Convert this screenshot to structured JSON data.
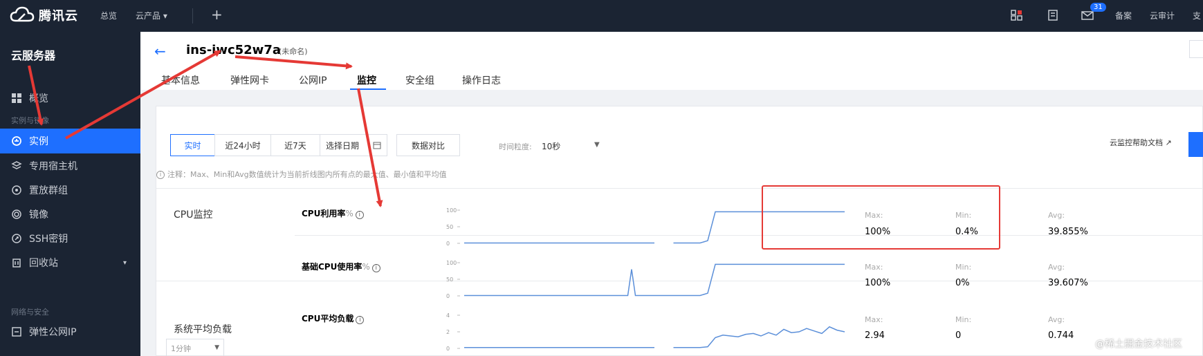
{
  "topbar": {
    "brand": "腾讯云",
    "nav": [
      "总览",
      "云产品 ▾"
    ],
    "plus": "+",
    "badge_count": "31",
    "right_links": [
      "备案",
      "云审计",
      "支"
    ]
  },
  "sidebar": {
    "title": "云服务器",
    "items": [
      {
        "label": "概览",
        "icon": "grid-icon"
      },
      {
        "label": "实例",
        "icon": "instance-icon",
        "active": true
      },
      {
        "label": "专用宿主机",
        "icon": "host-icon"
      },
      {
        "label": "置放群组",
        "icon": "placement-icon"
      },
      {
        "label": "镜像",
        "icon": "image-icon"
      },
      {
        "label": "SSH密钥",
        "icon": "key-icon"
      },
      {
        "label": "回收站",
        "icon": "trash-icon"
      },
      {
        "label": "弹性公网IP",
        "icon": "eip-icon"
      }
    ],
    "sections": [
      "实例与镜像",
      "网络与安全"
    ]
  },
  "header": {
    "instance_id": "ins-iwc52w7a",
    "instance_name": "(未命名)",
    "tabs": [
      "基本信息",
      "弹性网卡",
      "公网IP",
      "监控",
      "安全组",
      "操作日志"
    ],
    "active_tab": "监控"
  },
  "toolbar": {
    "segments": [
      "实时",
      "近24小时",
      "近7天",
      "选择日期"
    ],
    "compare": "数据对比",
    "granularity_label": "时间粒度:",
    "granularity_value": "10秒",
    "help": "云监控帮助文档"
  },
  "note": "注释：Max、Min和Avg数值统计为当前折线图内所有点的最大值、最小值和平均值",
  "groups": [
    {
      "label": "CPU监控"
    },
    {
      "label": "系统平均负载",
      "select": "1分钟"
    }
  ],
  "metrics": [
    {
      "name": "CPU利用率",
      "unit": "%",
      "max_label": "Max:",
      "max": "100%",
      "min_label": "Min:",
      "min": "0.4%",
      "avg_label": "Avg:",
      "avg": "39.855%"
    },
    {
      "name": "基础CPU使用率",
      "unit": "%",
      "max_label": "Max:",
      "max": "100%",
      "min_label": "Min:",
      "min": "0%",
      "avg_label": "Avg:",
      "avg": "39.607%"
    },
    {
      "name": "CPU平均负载",
      "unit": "",
      "max_label": "Max:",
      "max": "2.94",
      "min_label": "Min:",
      "min": "0",
      "avg_label": "Avg:",
      "avg": "0.744"
    }
  ],
  "chart_data": [
    {
      "type": "line",
      "title": "CPU利用率",
      "yticks": [
        0,
        50,
        100
      ],
      "ylim": [
        0,
        100
      ],
      "x": [
        0,
        5,
        10,
        15,
        20,
        25,
        30,
        35,
        40,
        45,
        50,
        52,
        55,
        60,
        62,
        64,
        66,
        70,
        80,
        90,
        100
      ],
      "series": [
        {
          "values": [
            1,
            1,
            1,
            1,
            1,
            1,
            1,
            1,
            1,
            1,
            1,
            null,
            1,
            1,
            1,
            8,
            95,
            95,
            95,
            95,
            95
          ]
        }
      ]
    },
    {
      "type": "line",
      "title": "基础CPU使用率",
      "yticks": [
        0,
        50,
        100
      ],
      "ylim": [
        0,
        100
      ],
      "x": [
        0,
        5,
        10,
        15,
        20,
        25,
        30,
        35,
        40,
        43,
        44,
        45,
        50,
        55,
        60,
        62,
        64,
        66,
        70,
        80,
        90,
        100
      ],
      "series": [
        {
          "values": [
            1,
            1,
            1,
            1,
            1,
            1,
            1,
            1,
            1,
            1,
            80,
            1,
            1,
            1,
            1,
            1,
            8,
            95,
            95,
            95,
            95,
            95
          ]
        }
      ]
    },
    {
      "type": "line",
      "title": "CPU平均负载",
      "yticks": [
        0,
        2,
        4
      ],
      "ylim": [
        0,
        4
      ],
      "x": [
        0,
        5,
        10,
        15,
        20,
        25,
        30,
        35,
        40,
        45,
        50,
        52,
        55,
        60,
        62,
        64,
        66,
        68,
        70,
        72,
        74,
        76,
        78,
        80,
        82,
        84,
        86,
        88,
        90,
        92,
        94,
        96,
        98,
        100
      ],
      "series": [
        {
          "values": [
            0.1,
            0.1,
            0.1,
            0.1,
            0.1,
            0.1,
            0.1,
            0.1,
            0.1,
            0.1,
            0.1,
            null,
            0.1,
            0.1,
            0.1,
            0.2,
            1.3,
            1.6,
            1.5,
            1.4,
            1.7,
            1.8,
            1.5,
            1.9,
            1.6,
            2.3,
            1.9,
            2.0,
            2.4,
            2.1,
            1.8,
            2.6,
            2.2,
            2.0
          ]
        }
      ]
    }
  ],
  "watermark": "@稀土掘金技术社区"
}
